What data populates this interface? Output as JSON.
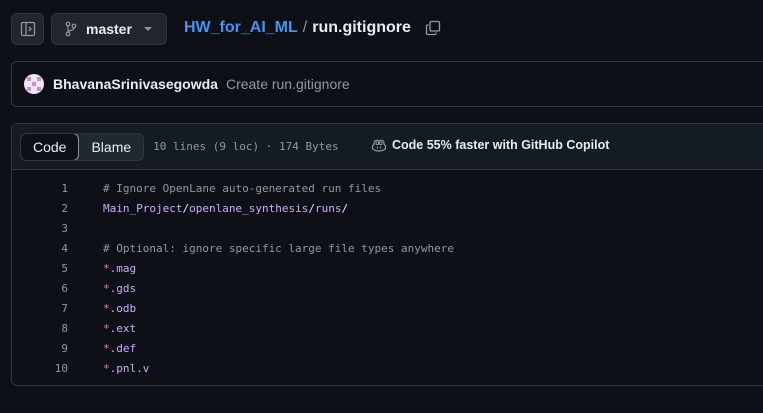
{
  "header": {
    "branch": "master",
    "repo": "HW_for_AI_ML",
    "separator": "/",
    "file": "run.gitignore"
  },
  "commit": {
    "author": "BhavanaSrinivasegowda",
    "message": "Create run.gitignore"
  },
  "file_view": {
    "tabs": [
      "Code",
      "Blame"
    ],
    "active_tab": "Code",
    "meta": "10 lines (9 loc) · 174 Bytes",
    "copilot_text": "Code 55% faster with GitHub Copilot"
  },
  "lines": [
    {
      "n": "1",
      "text": "# Ignore OpenLane auto-generated run files"
    },
    {
      "n": "2",
      "text": "Main_Project/openlane_synthesis/runs/"
    },
    {
      "n": "3",
      "text": ""
    },
    {
      "n": "4",
      "text": "# Optional: ignore specific large file types anywhere"
    },
    {
      "n": "5",
      "text": "*.mag"
    },
    {
      "n": "6",
      "text": "*.gds"
    },
    {
      "n": "7",
      "text": "*.odb"
    },
    {
      "n": "8",
      "text": "*.ext"
    },
    {
      "n": "9",
      "text": "*.def"
    },
    {
      "n": "10",
      "text": "*.pnl.v"
    }
  ],
  "colors": {
    "background": "#0d1117",
    "link": "#4493f8",
    "comment": "#9198a1",
    "path": "#d2a8ff",
    "glob": "#ff7b72"
  },
  "icons": [
    "sidebar-expand-icon",
    "git-branch-icon",
    "chevron-down-icon",
    "copy-icon",
    "copilot-icon"
  ]
}
